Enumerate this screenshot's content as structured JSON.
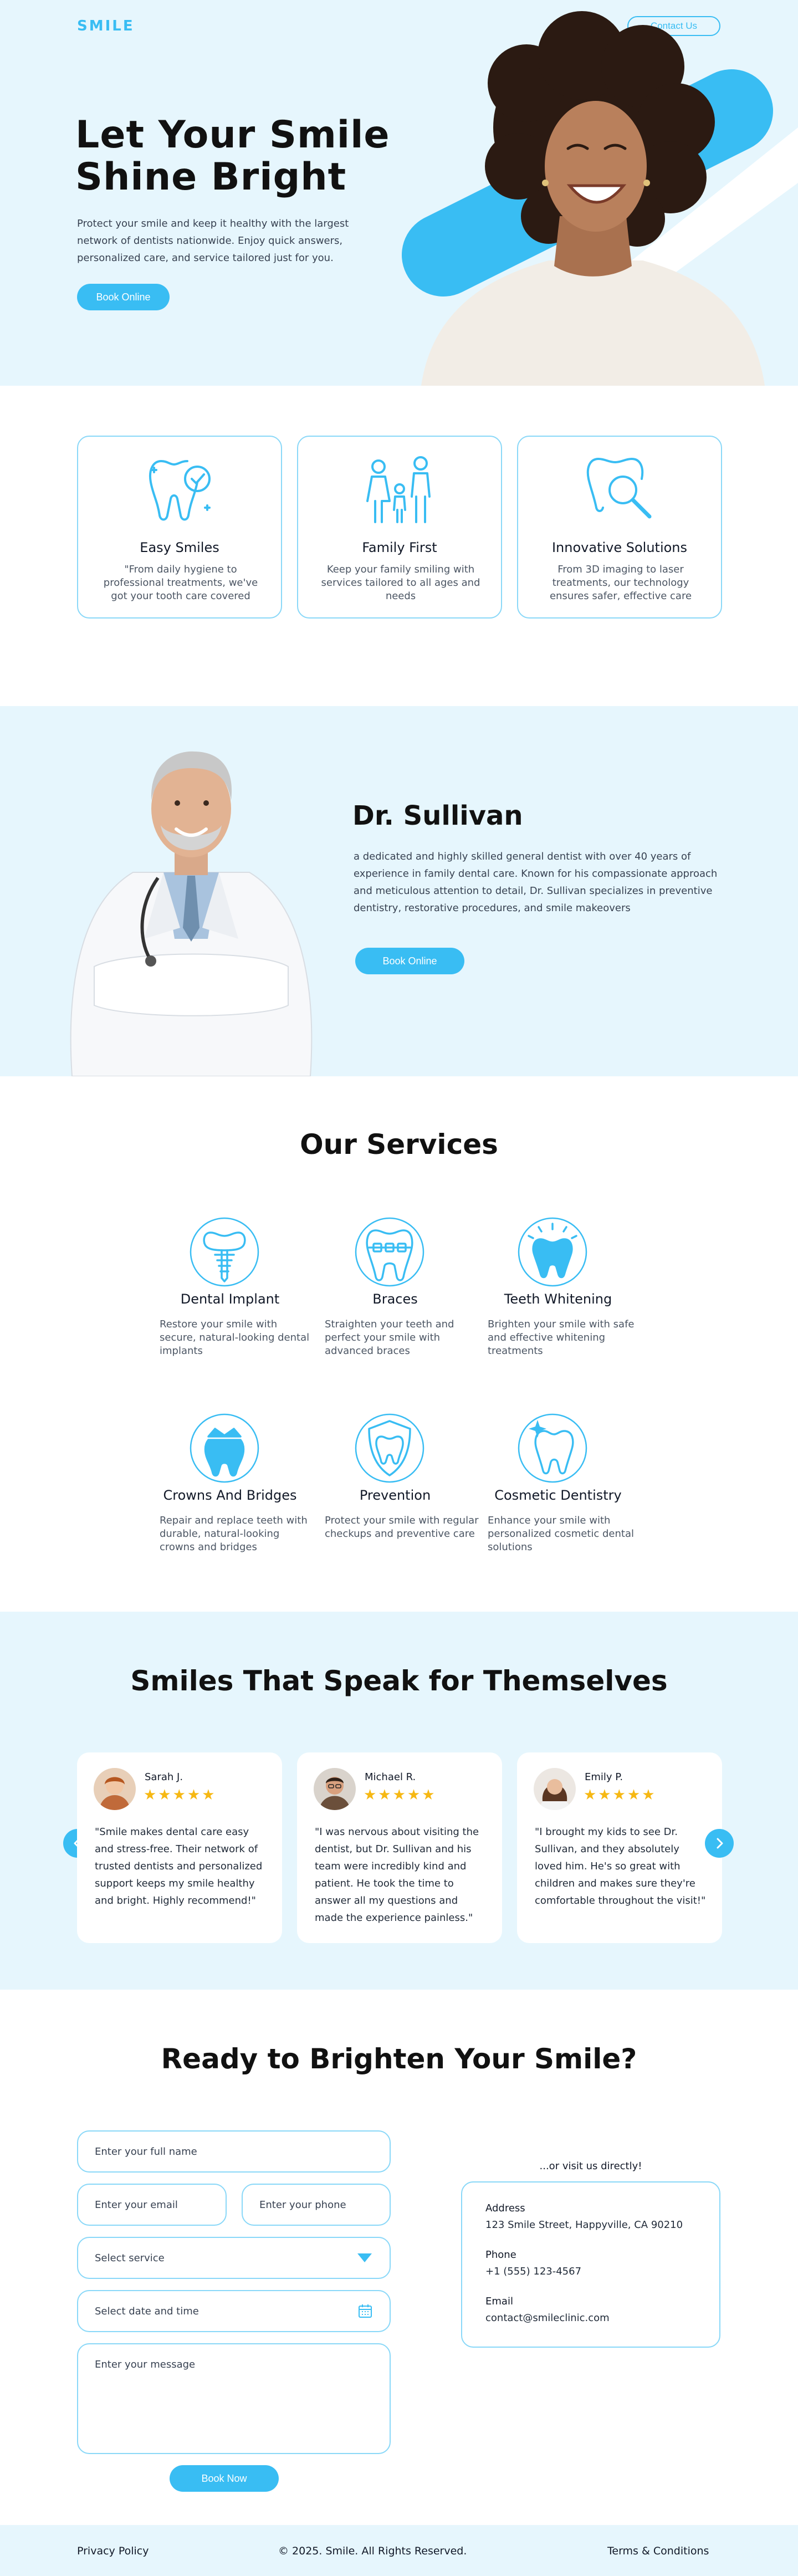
{
  "header": {
    "logo": "SMILE",
    "contact_label": "Contact Us"
  },
  "hero": {
    "title": "Let Your Smile Shine Bright",
    "text": "Protect your smile and keep it healthy with the largest network of dentists nationwide. Enjoy quick answers, personalized care, and service tailored just for you.",
    "cta": "Book Online"
  },
  "features": [
    {
      "title": "Easy Smiles",
      "text": "\"From daily hygiene to professional treatments, we've got your tooth care covered"
    },
    {
      "title": "Family First",
      "text": "Keep your family smiling with services tailored to all ages and needs"
    },
    {
      "title": "Innovative Solutions",
      "text": "From 3D imaging to laser treatments, our technology ensures safer, effective care"
    }
  ],
  "doctor": {
    "name": "Dr. Sullivan",
    "bio": "a dedicated and highly skilled general dentist with over 40 years of experience in family dental care. Known for his compassionate approach and meticulous attention to detail, Dr. Sullivan specializes in preventive dentistry, restorative procedures, and smile makeovers",
    "cta": "Book Online"
  },
  "services": {
    "title": "Our Services",
    "items": [
      {
        "title": "Dental Implant",
        "text": "Restore your smile with secure, natural-looking dental implants"
      },
      {
        "title": "Braces",
        "text": "Straighten your teeth and perfect your smile with advanced braces"
      },
      {
        "title": "Teeth Whitening",
        "text": "Brighten your smile with safe and effective whitening treatments"
      },
      {
        "title": "Crowns And Bridges",
        "text": "Repair and replace teeth with durable, natural-looking crowns and bridges"
      },
      {
        "title": "Prevention",
        "text": "Protect your smile with regular checkups and preventive care"
      },
      {
        "title": "Cosmetic Dentistry",
        "text": "Enhance your smile with personalized cosmetic dental solutions"
      }
    ]
  },
  "testimonials": {
    "title": "Smiles That Speak for Themselves",
    "items": [
      {
        "name": "Sarah J.",
        "stars": "★★★★★",
        "rating": 5,
        "quote": "\"Smile makes dental care easy and stress-free. Their network of trusted dentists and personalized support keeps my smile healthy and bright. Highly recommend!\""
      },
      {
        "name": "Michael R.",
        "stars": "★★★★★",
        "rating": 5,
        "quote": "\"I was nervous about visiting the dentist, but Dr. Sullivan and his team were incredibly kind and patient. He took the time to answer all my questions and made the experience painless.\""
      },
      {
        "name": "Emily P.",
        "stars": "★★★★★",
        "rating": 5,
        "quote": "\"I brought my kids to see Dr. Sullivan, and they absolutely loved him. He's so great with children and makes sure they're comfortable throughout the visit!\""
      }
    ]
  },
  "booking": {
    "title": "Ready to Brighten Your Smile?",
    "name_placeholder": "Enter your full name",
    "email_placeholder": "Enter your email",
    "phone_placeholder": "Enter your phone",
    "service_placeholder": "Select service",
    "datetime_placeholder": "Select date and time",
    "message_placeholder": "Enter your message",
    "submit": "Book Now",
    "visit_label": "...or visit us directly!",
    "address_label": "Address",
    "address": "123 Smile Street, Happyville, CA 90210",
    "phone_label": "Phone",
    "phone": "+1 (555) 123-4567",
    "email_label": "Email",
    "email": "contact@smileclinic.com"
  },
  "footer": {
    "privacy": "Privacy Policy",
    "copyright": "© 2025. Smile. All Rights Reserved.",
    "terms": "Terms & Conditions"
  },
  "colors": {
    "accent": "#39bdf3",
    "light_bg": "#e6f6fd",
    "border": "#8ad8f8",
    "star": "#f6b813"
  }
}
